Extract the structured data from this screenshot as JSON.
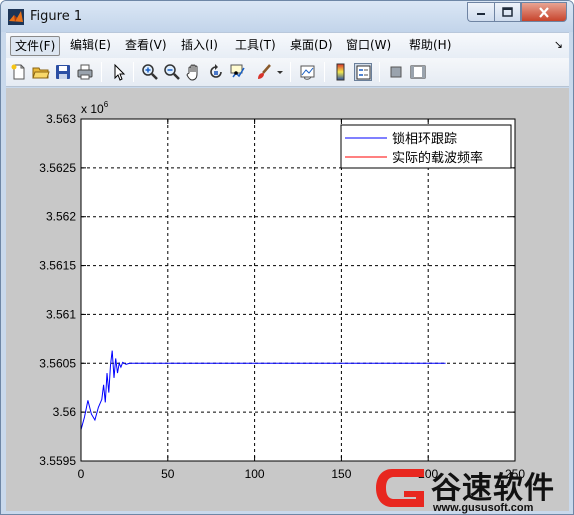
{
  "window": {
    "title": "Figure 1"
  },
  "menu": {
    "items": [
      {
        "label": "文件(F)",
        "active": true
      },
      {
        "label": "编辑(E)"
      },
      {
        "label": "查看(V)"
      },
      {
        "label": "插入(I)"
      },
      {
        "label": "工具(T)"
      },
      {
        "label": "桌面(D)"
      },
      {
        "label": "窗口(W)"
      },
      {
        "label": "帮助(H)"
      }
    ],
    "dock_glyph": "↘"
  },
  "toolbar": {
    "icons": [
      "new-figure-icon",
      "open-file-icon",
      "save-icon",
      "print-icon",
      "pointer-icon",
      "zoom-in-icon",
      "zoom-out-icon",
      "pan-icon",
      "rotate-3d-icon",
      "data-cursor-icon",
      "brush-icon",
      "brush-dropdown-icon",
      "link-plot-icon",
      "colorbar-icon",
      "legend-icon",
      "hide-plot-tools-icon",
      "show-plot-tools-icon"
    ]
  },
  "chart_data": {
    "type": "line",
    "title": "",
    "xlabel": "",
    "ylabel": "",
    "y_exponent": "x 10",
    "y_exponent_power": "6",
    "xlim": [
      0,
      250
    ],
    "ylim": [
      3.5595,
      3.563
    ],
    "xticks": [
      "0",
      "50",
      "100",
      "150",
      "200",
      "250"
    ],
    "yticks": [
      "3.5595",
      "3.56",
      "3.5605",
      "3.561",
      "3.5615",
      "3.562",
      "3.5625",
      "3.563"
    ],
    "grid": true,
    "legend_position": "top-right",
    "series": [
      {
        "name": "锁相环跟踪",
        "color": "#0000ff",
        "x": [
          0,
          2,
          4,
          6,
          8,
          10,
          12,
          13,
          14,
          15,
          16,
          17,
          18,
          19,
          20,
          21,
          22,
          23,
          24,
          26,
          28,
          30,
          40,
          60,
          80,
          100,
          120,
          140,
          160,
          180,
          200,
          210
        ],
        "y": [
          3.55982,
          3.55995,
          3.56012,
          3.55998,
          3.55992,
          3.56005,
          3.56013,
          3.56028,
          3.5601,
          3.5604,
          3.5602,
          3.56048,
          3.56063,
          3.56035,
          3.56055,
          3.5604,
          3.5605,
          3.56046,
          3.56051,
          3.56049,
          3.5605,
          3.5605,
          3.5605,
          3.5605,
          3.5605,
          3.5605,
          3.5605,
          3.5605,
          3.5605,
          3.5605,
          3.5605,
          3.5605
        ]
      },
      {
        "name": "实际的载波频率",
        "color": "#ff0000",
        "x": [],
        "y": []
      }
    ]
  },
  "watermark": {
    "brand": "谷速软件",
    "url": "www.gususoft.com"
  },
  "colors": {
    "figure_bg": "#c8c8c8",
    "axes_bg": "#ffffff",
    "series_blue": "#0000ff",
    "series_red": "#ff0000",
    "watermark_red": "#e8271f"
  }
}
